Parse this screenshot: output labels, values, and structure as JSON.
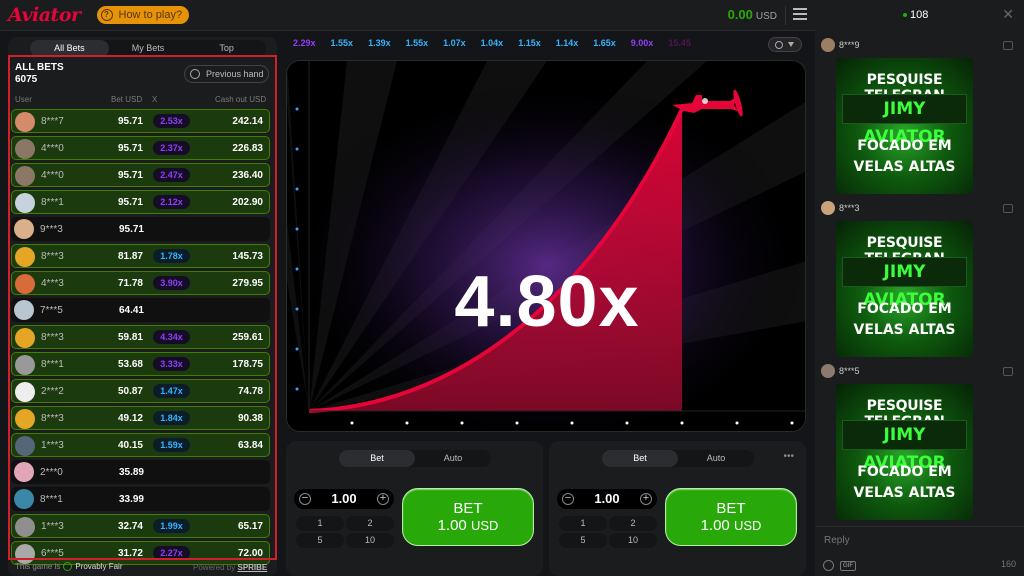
{
  "header": {
    "logo": "Aviator",
    "how_to_play": "How to play?",
    "balance": "0.00",
    "currency": "USD"
  },
  "bets_panel": {
    "tabs": [
      "All Bets",
      "My Bets",
      "Top"
    ],
    "title": "ALL BETS",
    "count": "6075",
    "previous_hand": "Previous hand",
    "columns": [
      "User",
      "Bet USD",
      "X",
      "Cash out USD"
    ],
    "rows": [
      {
        "user": "8***7",
        "bet": "95.71",
        "x": "2.53x",
        "cash": "242.14",
        "win": true,
        "color": "purple",
        "avatar": "#d38b6a"
      },
      {
        "user": "4***0",
        "bet": "95.71",
        "x": "2.37x",
        "cash": "226.83",
        "win": true,
        "color": "purple",
        "avatar": "#8a7766"
      },
      {
        "user": "4***0",
        "bet": "95.71",
        "x": "2.47x",
        "cash": "236.40",
        "win": true,
        "color": "purple",
        "avatar": "#8a7766"
      },
      {
        "user": "8***1",
        "bet": "95.71",
        "x": "2.12x",
        "cash": "202.90",
        "win": true,
        "color": "purple",
        "avatar": "#c6d3df"
      },
      {
        "user": "9***3",
        "bet": "95.71",
        "x": "",
        "cash": "",
        "win": false,
        "color": "",
        "avatar": "#d9b08a"
      },
      {
        "user": "8***3",
        "bet": "81.87",
        "x": "1.78x",
        "cash": "145.73",
        "win": true,
        "color": "blue",
        "avatar": "#e5a626"
      },
      {
        "user": "4***3",
        "bet": "71.78",
        "x": "3.90x",
        "cash": "279.95",
        "win": true,
        "color": "purple",
        "avatar": "#d86b3a"
      },
      {
        "user": "7***5",
        "bet": "64.41",
        "x": "",
        "cash": "",
        "win": false,
        "color": "",
        "avatar": "#b9c5cf"
      },
      {
        "user": "8***3",
        "bet": "59.81",
        "x": "4.34x",
        "cash": "259.61",
        "win": true,
        "color": "purple",
        "avatar": "#e5a626"
      },
      {
        "user": "8***1",
        "bet": "53.68",
        "x": "3.33x",
        "cash": "178.75",
        "win": true,
        "color": "purple",
        "avatar": "#999999"
      },
      {
        "user": "2***2",
        "bet": "50.87",
        "x": "1.47x",
        "cash": "74.78",
        "win": true,
        "color": "blue",
        "avatar": "#eeeeee"
      },
      {
        "user": "8***3",
        "bet": "49.12",
        "x": "1.84x",
        "cash": "90.38",
        "win": true,
        "color": "blue",
        "avatar": "#e5a626"
      },
      {
        "user": "1***3",
        "bet": "40.15",
        "x": "1.59x",
        "cash": "63.84",
        "win": true,
        "color": "blue",
        "avatar": "#556677"
      },
      {
        "user": "2***0",
        "bet": "35.89",
        "x": "",
        "cash": "",
        "win": false,
        "color": "",
        "avatar": "#e2a6b9"
      },
      {
        "user": "8***1",
        "bet": "33.99",
        "x": "",
        "cash": "",
        "win": false,
        "color": "",
        "avatar": "#3a87a8"
      },
      {
        "user": "1***3",
        "bet": "32.74",
        "x": "1.99x",
        "cash": "65.17",
        "win": true,
        "color": "blue",
        "avatar": "#8f8f8f"
      },
      {
        "user": "6***5",
        "bet": "31.72",
        "x": "2.27x",
        "cash": "72.00",
        "win": true,
        "color": "purple",
        "avatar": "#a9a9a9"
      }
    ],
    "footer_prefix": "This game is",
    "provably_fair": "Provably Fair",
    "powered_by": "Powered by",
    "brand": "SPRIBE"
  },
  "history": [
    {
      "v": "2.29x",
      "c": "#913ef8"
    },
    {
      "v": "1.55x",
      "c": "#34b4ff"
    },
    {
      "v": "1.39x",
      "c": "#34b4ff"
    },
    {
      "v": "1.55x",
      "c": "#34b4ff"
    },
    {
      "v": "1.07x",
      "c": "#34b4ff"
    },
    {
      "v": "1.04x",
      "c": "#34b4ff"
    },
    {
      "v": "1.15x",
      "c": "#34b4ff"
    },
    {
      "v": "1.14x",
      "c": "#34b4ff"
    },
    {
      "v": "1.65x",
      "c": "#34b4ff"
    },
    {
      "v": "9.00x",
      "c": "#913ef8"
    },
    {
      "v": "15.45",
      "c": "#c017b4"
    }
  ],
  "game": {
    "multiplier": "4.80x",
    "curve_color": "#e50539"
  },
  "bet_panels": [
    {
      "tabs": [
        "Bet",
        "Auto"
      ],
      "amount": "1.00",
      "quick": [
        "1",
        "2",
        "5",
        "10"
      ],
      "btn_label": "BET",
      "btn_amount": "1.00",
      "btn_currency": "USD"
    },
    {
      "tabs": [
        "Bet",
        "Auto"
      ],
      "amount": "1.00",
      "quick": [
        "1",
        "2",
        "5",
        "10"
      ],
      "btn_label": "BET",
      "btn_amount": "1.00",
      "btn_currency": "USD"
    }
  ],
  "chat": {
    "online": "108",
    "messages": [
      {
        "user": "8***9",
        "gif": [
          "PESQUISE TELEGRAN",
          "JIMY AVIATOR",
          "FOCADO EM",
          "VELAS ALTAS"
        ]
      },
      {
        "user": "8***3",
        "gif": [
          "PESQUISE TELEGRAN",
          "JIMY AVIATOR",
          "FOCADO EM",
          "VELAS ALTAS"
        ]
      },
      {
        "user": "8***5",
        "gif": [
          "PESQUISE TELEGRAN",
          "JIMY AVIATOR",
          "FOCADO EM",
          "VELAS ALTAS"
        ]
      }
    ],
    "reply_placeholder": "Reply",
    "char_limit": "160",
    "gif_label": "GIF"
  },
  "colors": {
    "accent_red": "#e50539",
    "win_green": "#28a909",
    "blue_mult": "#34b4ff",
    "purple_mult": "#913ef8"
  }
}
